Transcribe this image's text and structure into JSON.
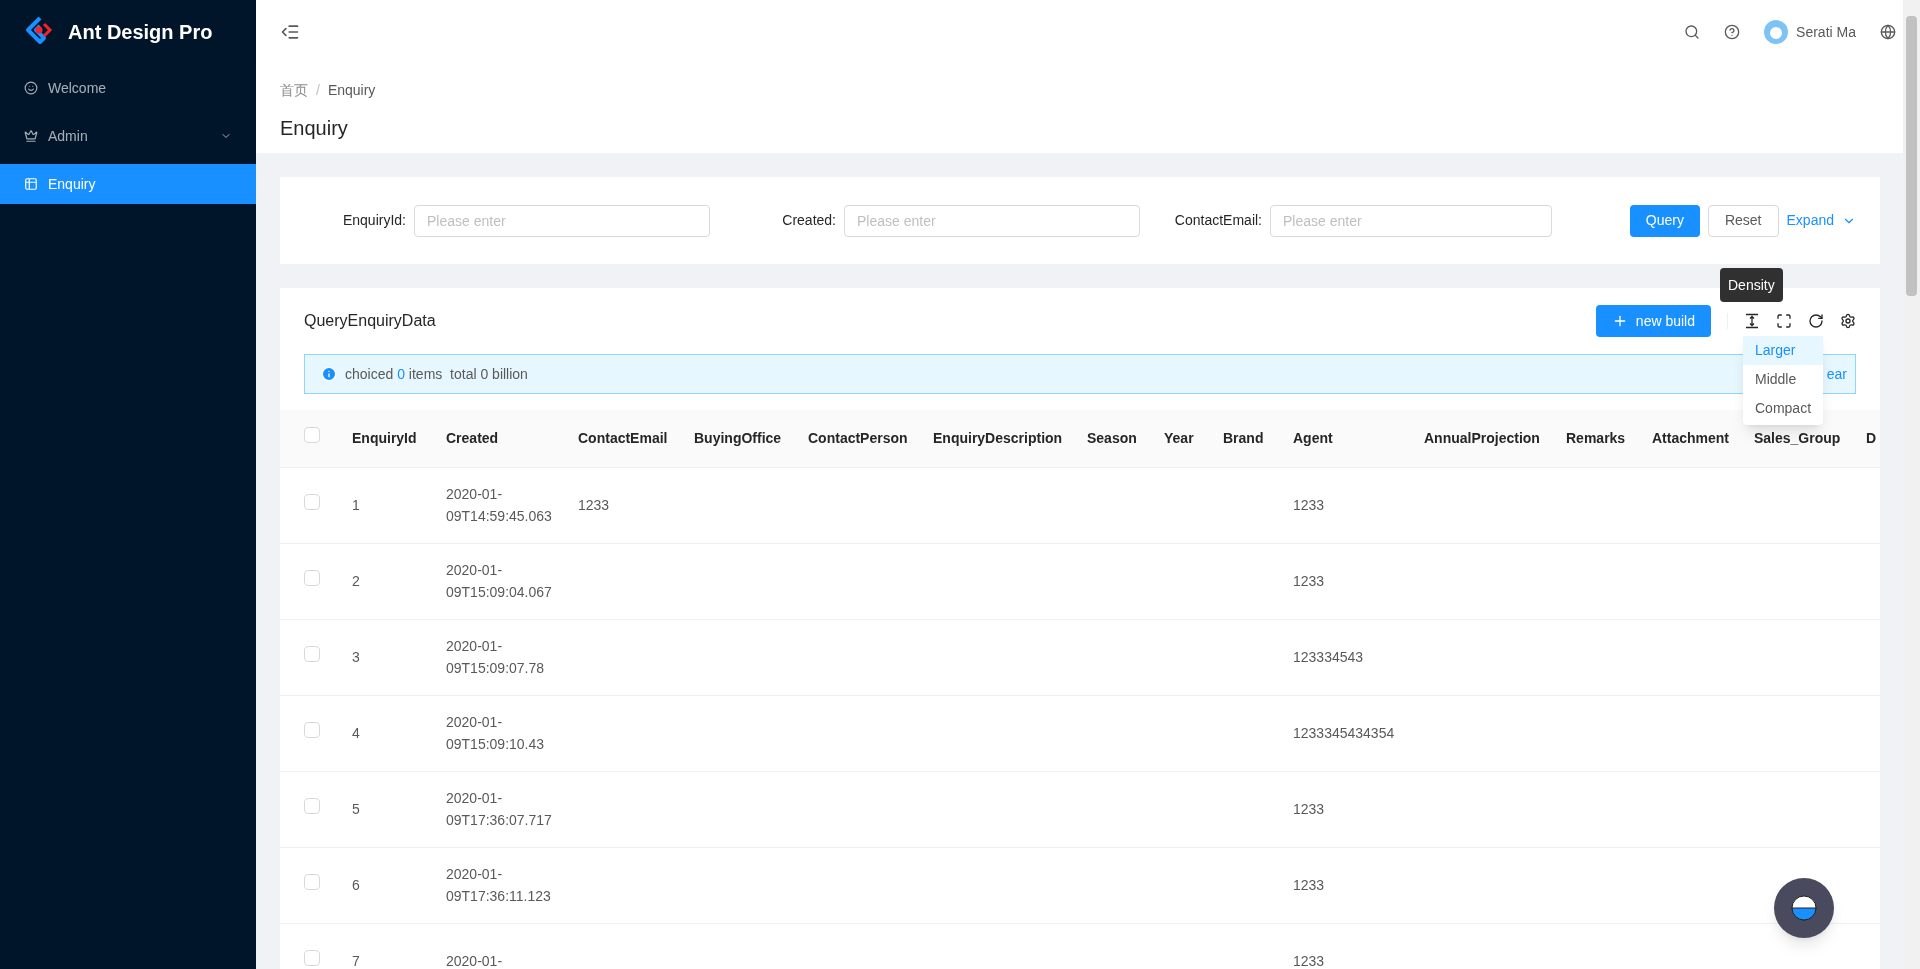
{
  "brand": {
    "title": "Ant Design Pro"
  },
  "sidebar": {
    "items": [
      {
        "label": "Welcome",
        "kind": "link",
        "selected": false
      },
      {
        "label": "Admin",
        "kind": "submenu",
        "selected": false
      },
      {
        "label": "Enquiry",
        "kind": "link",
        "selected": true
      }
    ]
  },
  "header": {
    "user": "Serati Ma"
  },
  "breadcrumb": [
    "首页",
    "Enquiry"
  ],
  "breadcrumb_separator": "/",
  "page_title": "Enquiry",
  "filters": {
    "fields": [
      {
        "label": "EnquiryId:",
        "placeholder": "Please enter"
      },
      {
        "label": "Created:",
        "placeholder": "Please enter"
      },
      {
        "label": "ContactEmail:",
        "placeholder": "Please enter"
      }
    ],
    "query": "Query",
    "reset": "Reset",
    "expand": "Expand"
  },
  "table_card": {
    "title": "QueryEnquiryData",
    "new_button": "new build",
    "tooltip": "Density",
    "density_menu": [
      {
        "label": "Larger",
        "selected": true
      },
      {
        "label": "Middle",
        "selected": false
      },
      {
        "label": "Compact",
        "selected": false
      }
    ],
    "alert": {
      "prefix": "choiced",
      "count": "0",
      "suffix": "items  total 0 billion",
      "action": "ear"
    }
  },
  "table": {
    "select_all": {
      "selected": false
    },
    "columns": [
      "EnquiryId",
      "Created",
      "ContactEmail",
      "BuyingOffice",
      "ContactPerson",
      "EnquiryDescription",
      "Season",
      "Year",
      "Brand",
      "Agent",
      "AnnualProjection",
      "Remarks",
      "Attachment",
      "Sales_Group",
      "D"
    ],
    "rows": [
      {
        "selected": false,
        "cells": {
          "EnquiryId": "1",
          "Created": "2020-01-09T14:59:45.063",
          "ContactEmail": "1233",
          "Agent": "1233"
        }
      },
      {
        "selected": false,
        "cells": {
          "EnquiryId": "2",
          "Created": "2020-01-09T15:09:04.067",
          "Agent": "1233"
        }
      },
      {
        "selected": false,
        "cells": {
          "EnquiryId": "3",
          "Created": "2020-01-09T15:09:07.78",
          "Agent": "123334543"
        }
      },
      {
        "selected": false,
        "cells": {
          "EnquiryId": "4",
          "Created": "2020-01-09T15:09:10.43",
          "Agent": "1233345434354"
        }
      },
      {
        "selected": false,
        "cells": {
          "EnquiryId": "5",
          "Created": "2020-01-09T17:36:07.717",
          "Agent": "1233"
        }
      },
      {
        "selected": false,
        "cells": {
          "EnquiryId": "6",
          "Created": "2020-01-09T17:36:11.123",
          "Agent": "1233"
        }
      },
      {
        "selected": false,
        "cells": {
          "EnquiryId": "7",
          "Created": "2020-01-",
          "Agent": "1233"
        }
      }
    ]
  }
}
